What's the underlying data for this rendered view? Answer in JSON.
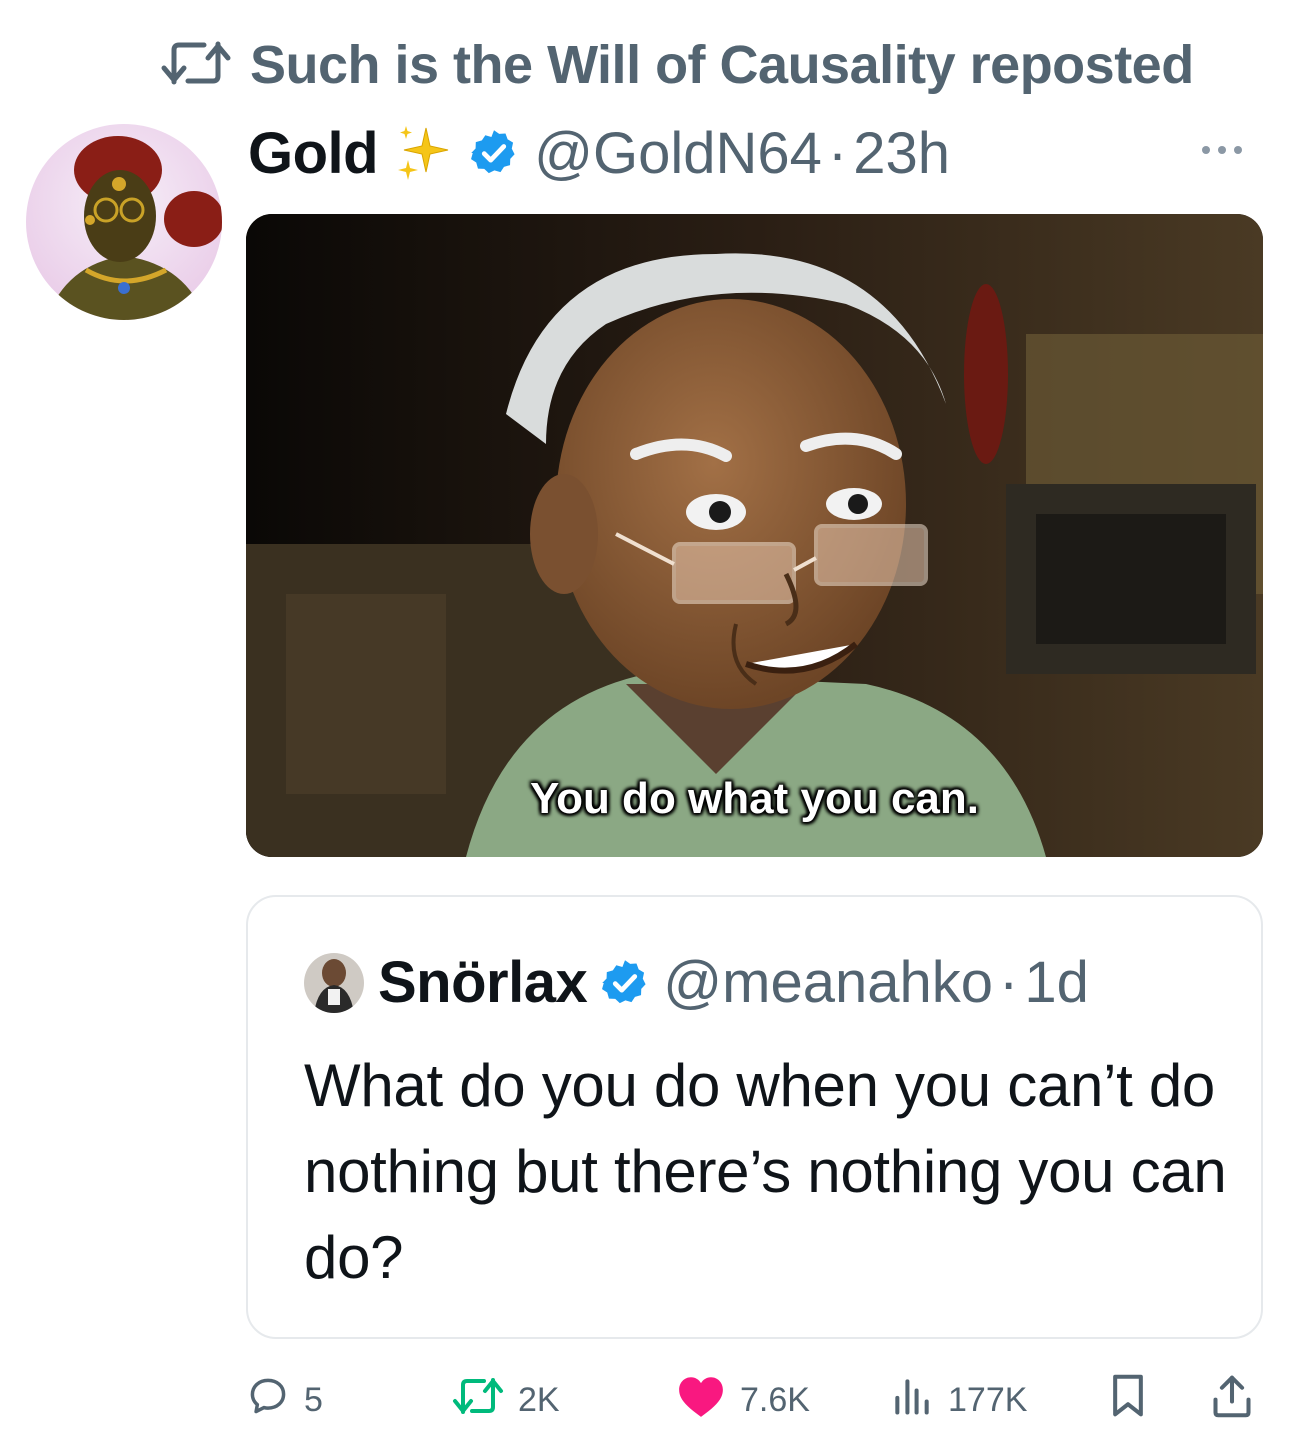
{
  "repost": {
    "label": "Such is the Will of Causality reposted",
    "icon": "repost-icon"
  },
  "post": {
    "author_name": "Gold",
    "author_emoji": "sparkles-icon",
    "verified": true,
    "handle": "@GoldN64",
    "separator": "·",
    "time": "23h",
    "more_icon": "more-icon",
    "media": {
      "subtitle": "You do what you can."
    }
  },
  "quoted": {
    "author_name": "Snörlax",
    "verified": true,
    "handle": "@meanahko",
    "separator": "·",
    "time": "1d",
    "text": "What do you do when you can’t do nothing but there’s nothing you can do?"
  },
  "actions": {
    "replies": "5",
    "reposts": "2K",
    "likes": "7.6K",
    "views": "177K"
  },
  "colors": {
    "text_primary": "#0f1419",
    "text_secondary": "#536471",
    "verified_blue": "#1d9bf0",
    "repost_green": "#00ba7c",
    "like_pink": "#f91880",
    "border": "#e6e9ec"
  }
}
